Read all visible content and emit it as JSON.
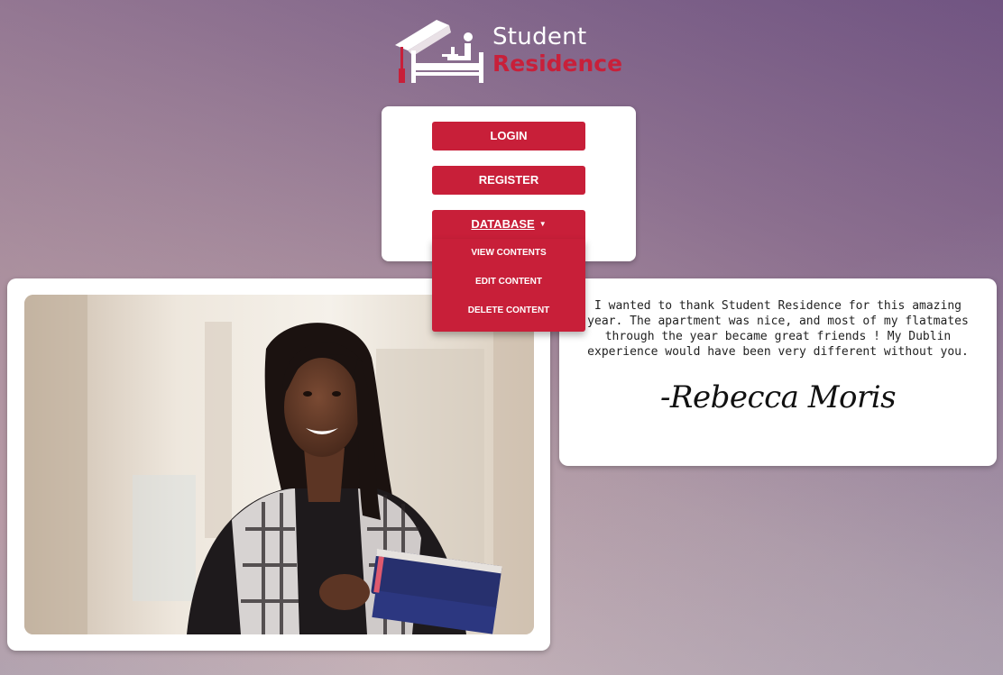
{
  "brand": {
    "word1": "Student",
    "word2": "Residence",
    "accent_color": "#c81f39"
  },
  "nav": {
    "login_label": "LOGIN",
    "register_label": "REGISTER",
    "database_label": "DATABASE",
    "database_caret": "▼",
    "database_menu": [
      {
        "label": "VIEW CONTENTS"
      },
      {
        "label": "EDIT CONTENT"
      },
      {
        "label": "DELETE CONTENT"
      }
    ]
  },
  "testimonial": {
    "text": "I wanted to thank Student Residence for this amazing year. The apartment was nice, and most of my flatmates through the year became great friends ! My Dublin experience would have been very different without you.",
    "signature": "-Rebecca Moris"
  }
}
